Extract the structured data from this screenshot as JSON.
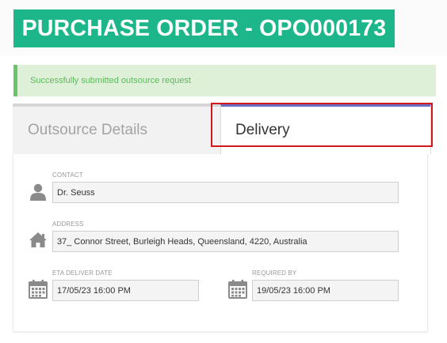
{
  "header": {
    "title": "PURCHASE ORDER - OPO000173"
  },
  "alert": {
    "message": "Successfully submitted outsource request"
  },
  "tabs": [
    {
      "label": "Outsource Details",
      "active": false
    },
    {
      "label": "Delivery",
      "active": true
    }
  ],
  "delivery": {
    "contact": {
      "label": "CONTACT",
      "value": "Dr. Seuss",
      "icon": "user-icon"
    },
    "address": {
      "label": "ADDRESS",
      "value": "37_ Connor Street, Burleigh Heads, Queensland, 4220, Australia",
      "icon": "home-icon"
    },
    "eta_deliver_date": {
      "label": "ETA DELIVER DATE",
      "value": "17/05/23 16:00 PM",
      "icon": "calendar-icon"
    },
    "required_by": {
      "label": "REQUIRED BY",
      "value": "19/05/23 16:00 PM",
      "icon": "calendar-icon"
    }
  },
  "colors": {
    "header_bg": "#1db58a",
    "alert_bg": "#dff0d8",
    "alert_text": "#5cb85c",
    "active_tab_accent": "#6a6fc4",
    "highlight_border": "#d0191b"
  }
}
